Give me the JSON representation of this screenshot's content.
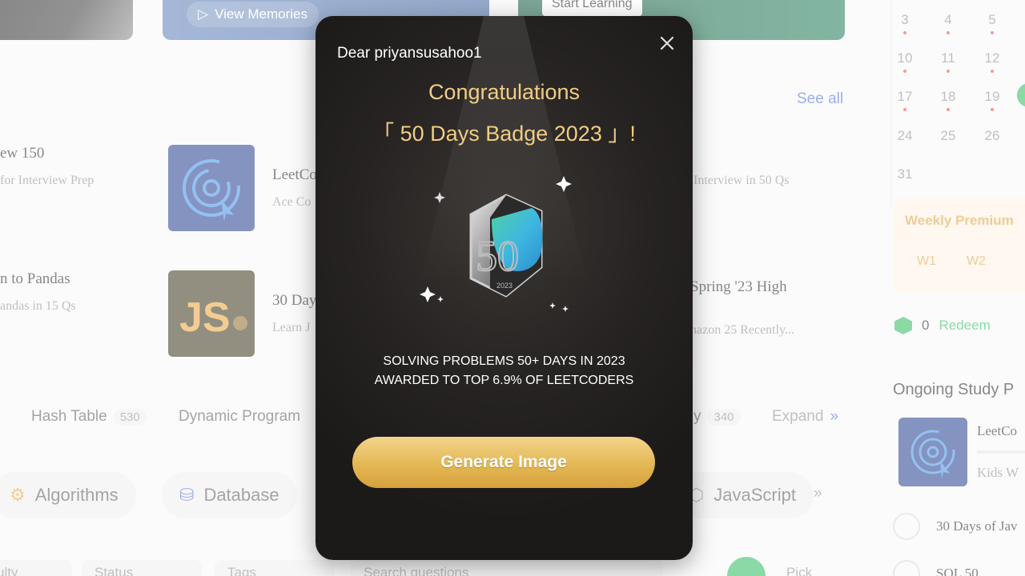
{
  "banners": {
    "view_memories": "View Memories",
    "start_learning": "Start Learning"
  },
  "section": {
    "see_all": "See all"
  },
  "courses": [
    {
      "title": "ew 150",
      "subtitle": "for Interview Prep"
    },
    {
      "title": "LeetCo",
      "subtitle": "Ace Co"
    },
    {
      "title": "",
      "subtitle": "Interview in 50 Qs"
    },
    {
      "title": "n to Pandas",
      "subtitle": "andas in 15 Qs"
    },
    {
      "title": "30 Day",
      "subtitle": "Learn J"
    },
    {
      "title": "Spring '23 High",
      "subtitle": "nazon 25 Recently..."
    }
  ],
  "tags": {
    "hash_table": "Hash Table",
    "hash_table_count": "530",
    "dynamic_programming": "Dynamic Program",
    "right_partial": "y",
    "right_count": "340",
    "expand": "Expand"
  },
  "categories": {
    "algorithms": "Algorithms",
    "database": "Database",
    "javascript": "JavaScript",
    "more": "»"
  },
  "filters": {
    "f1": "ulty",
    "status": "Status",
    "tags": "Tags",
    "search_placeholder": "Search questions",
    "pick_one": "Pick One"
  },
  "calendar": {
    "days": [
      "3",
      "4",
      "5",
      "10",
      "11",
      "12",
      "17",
      "18",
      "19",
      "24",
      "25",
      "26",
      "31"
    ]
  },
  "premium": {
    "title": "Weekly Premium",
    "w1": "W1",
    "w2": "W2"
  },
  "redeem": {
    "count": "0",
    "label": "Redeem"
  },
  "study": {
    "title": "Ongoing Study P",
    "item_title": "LeetCo",
    "item_sub": "Kids W",
    "plan1": "30 Days of Jav",
    "plan2": "SQL 50"
  },
  "modal": {
    "greeting": "Dear priyansusahoo1",
    "congrats": "Congratulations",
    "badge_name": "「 50 Days Badge 2023 」!",
    "badge_number": "50",
    "badge_year": "2023",
    "desc_line1": "SOLVING PROBLEMS 50+ DAYS IN 2023",
    "desc_line2": "AWARDED TO TOP 6.9% OF LEETCODERS",
    "generate_button": "Generate Image"
  },
  "colors": {
    "gold": "#f0cd82",
    "button_gold": "#e2b550",
    "modal_bg": "#262322",
    "link_blue": "#4a6fd9",
    "redeem_green": "#2cbb5d"
  }
}
